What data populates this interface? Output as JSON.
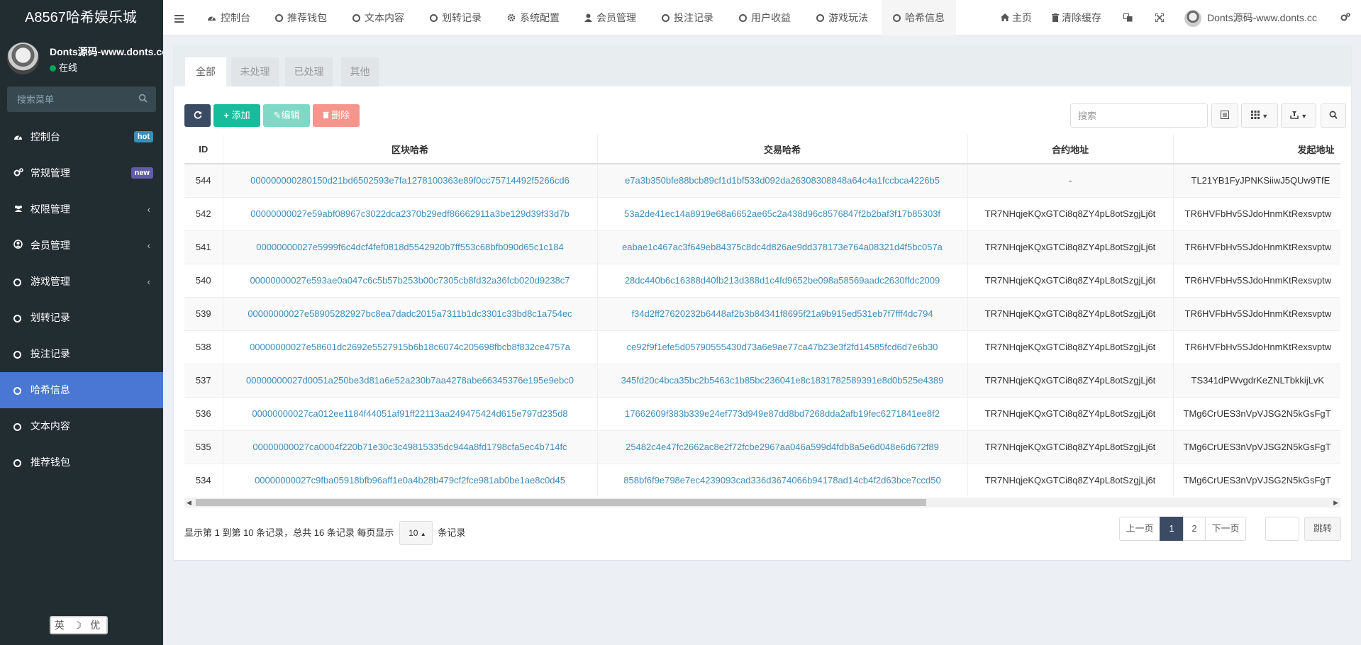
{
  "app": {
    "title": "A8567哈希娱乐城"
  },
  "user": {
    "name": "Donts源码-www.donts.cc",
    "status": "在线"
  },
  "sidebar": {
    "search_placeholder": "搜索菜单",
    "items": [
      {
        "label": "控制台",
        "icon": "dashboard-icon",
        "badge": "hot"
      },
      {
        "label": "常规管理",
        "icon": "cogs-icon",
        "badge": "new"
      },
      {
        "label": "权限管理",
        "icon": "group-icon",
        "caret": "‹"
      },
      {
        "label": "会员管理",
        "icon": "user-circle-icon",
        "caret": "‹"
      },
      {
        "label": "游戏管理",
        "icon": "circle-icon",
        "caret": "‹"
      },
      {
        "label": "划转记录",
        "icon": "circle-icon"
      },
      {
        "label": "投注记录",
        "icon": "circle-icon"
      },
      {
        "label": "哈希信息",
        "icon": "circle-icon",
        "active": true
      },
      {
        "label": "文本内容",
        "icon": "circle-icon"
      },
      {
        "label": "推荐钱包",
        "icon": "circle-icon"
      }
    ],
    "lang_widget": "英 ☽ 优"
  },
  "topnav": {
    "items": [
      {
        "label": "控制台",
        "icon": "dashboard-icon"
      },
      {
        "label": "推荐钱包",
        "icon": "circle-icon"
      },
      {
        "label": "文本内容",
        "icon": "circle-icon"
      },
      {
        "label": "划转记录",
        "icon": "circle-icon"
      },
      {
        "label": "系统配置",
        "icon": "gear-icon"
      },
      {
        "label": "会员管理",
        "icon": "user-icon"
      },
      {
        "label": "投注记录",
        "icon": "circle-icon"
      },
      {
        "label": "用户收益",
        "icon": "circle-icon"
      },
      {
        "label": "游戏玩法",
        "icon": "circle-icon"
      },
      {
        "label": "哈希信息",
        "icon": "circle-icon",
        "active": true
      }
    ],
    "home": "主页",
    "clear_cache": "清除缓存",
    "user_name": "Donts源码-www.donts.cc"
  },
  "tabs": [
    "全部",
    "未处理",
    "已处理",
    "其他"
  ],
  "toolbar": {
    "add": "添加",
    "edit": "编辑",
    "delete": "删除",
    "search_placeholder": "搜索"
  },
  "table": {
    "columns": [
      "ID",
      "区块哈希",
      "交易哈希",
      "合约地址",
      "发起地址"
    ],
    "rows": [
      [
        "544",
        "000000000280150d21bd6502593e7fa1278100363e89f0cc75714492f5266cd6",
        "e7a3b350bfe88bcb89cf1d1bf533d092da26308308848a64c4a1fccbca4226b5",
        "-",
        "TL21YB1FyJPNKSiiwJ5QUw9TfE"
      ],
      [
        "542",
        "00000000027e59abf08967c3022dca2370b29edf86662911a3be129d39f33d7b",
        "53a2de41ec14a8919e68a6652ae65c2a438d96c8576847f2b2baf3f17b85303f",
        "TR7NHqjeKQxGTCi8q8ZY4pL8otSzgjLj6t",
        "TR6HVFbHv5SJdoHnmKtRexsvptw"
      ],
      [
        "541",
        "00000000027e5999f6c4dcf4fef0818d5542920b7ff553c68bfb090d65c1c184",
        "eabae1c467ac3f649eb84375c8dc4d826ae9dd378173e764a08321d4f5bc057a",
        "TR7NHqjeKQxGTCi8q8ZY4pL8otSzgjLj6t",
        "TR6HVFbHv5SJdoHnmKtRexsvptw"
      ],
      [
        "540",
        "00000000027e593ae0a047c6c5b57b253b00c7305cb8fd32a36fcb020d9238c7",
        "28dc440b6c16388d40fb213d388d1c4fd9652be098a58569aadc2630ffdc2009",
        "TR7NHqjeKQxGTCi8q8ZY4pL8otSzgjLj6t",
        "TR6HVFbHv5SJdoHnmKtRexsvptw"
      ],
      [
        "539",
        "00000000027e58905282927bc8ea7dadc2015a7311b1dc3301c33bd8c1a754ec",
        "f34d2ff27620232b6448af2b3b84341f8695f21a9b915ed531eb7f7fff4dc794",
        "TR7NHqjeKQxGTCi8q8ZY4pL8otSzgjLj6t",
        "TR6HVFbHv5SJdoHnmKtRexsvptw"
      ],
      [
        "538",
        "00000000027e58601dc2692e5527915b6b18c6074c205698fbcb8f832ce4757a",
        "ce92f9f1efe5d05790555430d73a6e9ae77ca47b23e3f2fd14585fcd6d7e6b30",
        "TR7NHqjeKQxGTCi8q8ZY4pL8otSzgjLj6t",
        "TR6HVFbHv5SJdoHnmKtRexsvptw"
      ],
      [
        "537",
        "00000000027d0051a250be3d81a6e52a230b7aa4278abe66345376e195e9ebc0",
        "345fd20c4bca35bc2b5463c1b85bc236041e8c1831782589391e8d0b525e4389",
        "TR7NHqjeKQxGTCi8q8ZY4pL8otSzgjLj6t",
        "TS341dPWvgdrKeZNLTbkkijLvK"
      ],
      [
        "536",
        "00000000027ca012ee1184f44051af91ff22113aa249475424d615e797d235d8",
        "17662609f383b339e24ef773d949e87dd8bd7268dda2afb19fec6271841ee8f2",
        "TR7NHqjeKQxGTCi8q8ZY4pL8otSzgjLj6t",
        "TMg6CrUES3nVpVJSG2N5kGsFgT"
      ],
      [
        "535",
        "00000000027ca0004f220b71e30c3c49815335dc944a8fd1798cfa5ec4b714fc",
        "25482c4e47fc2662ac8e2f72fcbe2967aa046a599d4fdb8a5e6d048e6d672f89",
        "TR7NHqjeKQxGTCi8q8ZY4pL8otSzgjLj6t",
        "TMg6CrUES3nVpVJSG2N5kGsFgT"
      ],
      [
        "534",
        "00000000027c9fba05918bfb96aff1e0a4b28b479cf2fce981ab0be1ae8c0d45",
        "858bf6f9e798e7ec4239093cad336d3674066b94178ad14cb4f2d63bce7ccd50",
        "TR7NHqjeKQxGTCi8q8ZY4pL8otSzgjLj6t",
        "TMg6CrUES3nVpVJSG2N5kGsFgT"
      ]
    ]
  },
  "pagination": {
    "info_prefix": "显示第 1 到第 10 条记录，总共 16 条记录 每页显示",
    "page_size": "10",
    "info_suffix": "条记录",
    "prev": "上一页",
    "pages": [
      "1",
      "2"
    ],
    "current_page": "1",
    "next": "下一页",
    "jump": "跳转"
  },
  "colors": {
    "sidebar_bg": "#222d32",
    "active_menu": "#4a77d4",
    "refresh_btn": "#3c4b64",
    "add_btn": "#18bc9c",
    "edit_btn": "#7fd7c6",
    "delete_btn": "#f5958c",
    "link": "#3c8dbc"
  }
}
